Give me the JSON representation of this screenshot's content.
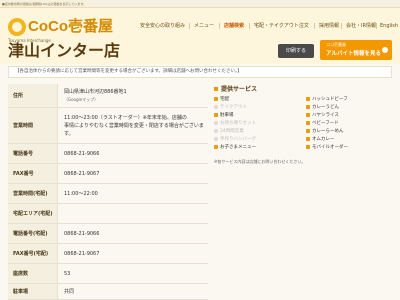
{
  "topbar": {
    "notice": "■店内飲食時の価格は消費税10%込の価格を表示しています。"
  },
  "brand": {
    "logo_text": "CoCo壱番屋",
    "subtitle": "Tsuyama Interchange",
    "store_title": "津山インター店"
  },
  "nav": {
    "items": [
      {
        "label": "安全安心の取り組み"
      },
      {
        "label": "メニュー"
      },
      {
        "label": "店舗検索"
      },
      {
        "label": "宅配・テイクアウト注文"
      },
      {
        "label": "採用情報"
      },
      {
        "label": "会社・IR情報"
      },
      {
        "label": "English"
      }
    ]
  },
  "actions": {
    "print": "印刷する",
    "recruit_small": "ココ壱番屋",
    "recruit_big": "アルバイト情報を見る"
  },
  "alert": {
    "text": "【各自治体からの要請に応じて営業時間等を変更する場合がございます。詳細は店舗へお問い合わせください。】"
  },
  "info": {
    "rows": [
      {
        "label": "住所",
        "lines": [
          "岡山県津山市河辺886番地1",
          "（Googleマップ）"
        ]
      },
      {
        "label": "営業時間",
        "lines": [
          "11:00～23:00（ラストオーダー）※年末年始、店舗の",
          "事情によりやむなく営業時間を変更・閉店する場合がございます。"
        ]
      },
      {
        "label": "電話番号",
        "value": "0868-21-9066"
      },
      {
        "label": "FAX番号",
        "value": "0868-21-9067"
      },
      {
        "label": "営業時間(宅配)",
        "value": "11:00～22:00"
      },
      {
        "label": "宅配エリア(宅配)",
        "value": ""
      },
      {
        "label": "電話番号(宅配)",
        "value": "0868-21-9066"
      },
      {
        "label": "FAX番号(宅配)",
        "value": "0868-21-9067"
      },
      {
        "label": "座席数",
        "value": "53"
      },
      {
        "label": "駐車場",
        "value": "共同"
      }
    ]
  },
  "services": {
    "title": "提供サービス",
    "items": [
      {
        "label": "宅配",
        "on": true
      },
      {
        "label": "テイクアウト",
        "on": false
      },
      {
        "label": "駐車場",
        "on": true
      },
      {
        "label": "お持ち帰りセット",
        "on": false
      },
      {
        "label": "24時間営業",
        "on": false
      },
      {
        "label": "手作りハンバーグ",
        "on": false
      },
      {
        "label": "ハッシュドビーフ",
        "on": true
      },
      {
        "label": "カレーうどん",
        "on": true
      },
      {
        "label": "ハヤシライス",
        "on": true
      },
      {
        "label": "ベビーフード",
        "on": true
      },
      {
        "label": "カレーらーめん",
        "on": true
      },
      {
        "label": "オムカレー",
        "on": true
      },
      {
        "label": "お子さまメニュー",
        "on": true
      },
      {
        "label": "モバイルオーダー",
        "on": true
      }
    ],
    "note": "※各サービス内容は店舗にお問い合わせください。"
  },
  "colors": {
    "accent": "#f39800",
    "brand": "#d48a00",
    "heading": "#5a3b10"
  }
}
